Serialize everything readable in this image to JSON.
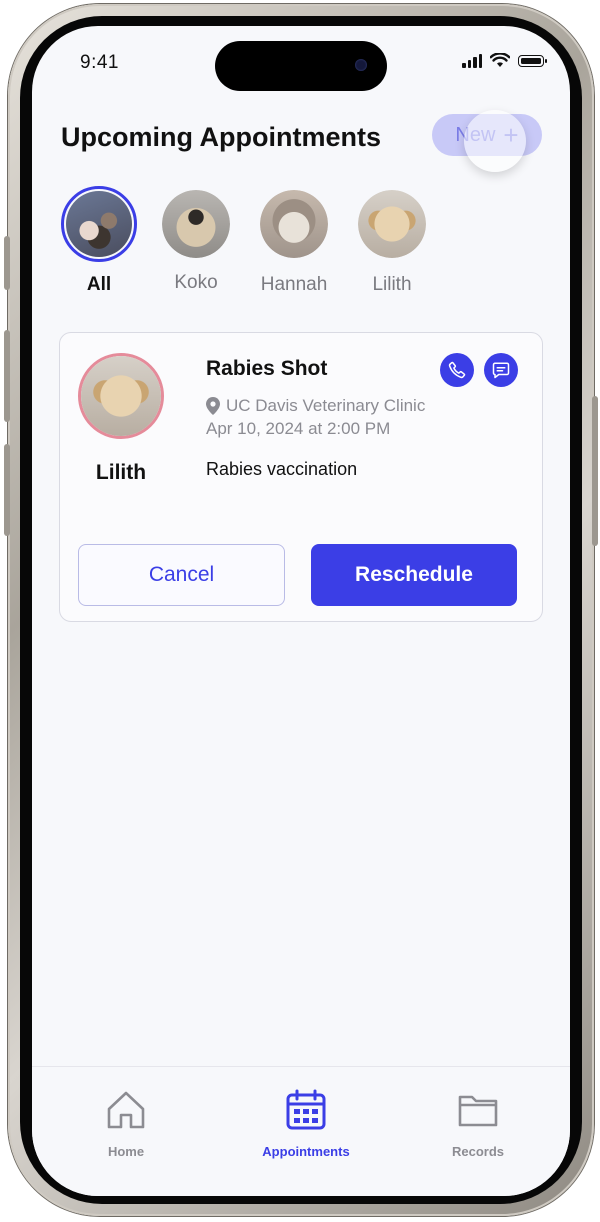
{
  "status_bar": {
    "time": "9:41"
  },
  "header": {
    "title": "Upcoming Appointments",
    "new_button_label": "New"
  },
  "pets": [
    {
      "name": "All",
      "photo": "group-photo"
    },
    {
      "name": "Koko",
      "photo": "pug-photo"
    },
    {
      "name": "Hannah",
      "photo": "cat-photo"
    },
    {
      "name": "Lilith",
      "photo": "golden-puppy-photo"
    }
  ],
  "appointment": {
    "pet_name": "Lilith",
    "title": "Rabies Shot",
    "clinic": "UC Davis Veterinary Clinic",
    "datetime": "Apr 10, 2024  at  2:00 PM",
    "notes": "Rabies vaccination",
    "cancel_label": "Cancel",
    "reschedule_label": "Reschedule"
  },
  "tabs": [
    {
      "label": "Home",
      "icon": "home-icon"
    },
    {
      "label": "Appointments",
      "icon": "calendar-icon"
    },
    {
      "label": "Records",
      "icon": "folder-icon"
    }
  ],
  "colors": {
    "accent": "#3b3ee6",
    "avatar_ring": "#e58b9a",
    "background": "#f7f8fb"
  }
}
